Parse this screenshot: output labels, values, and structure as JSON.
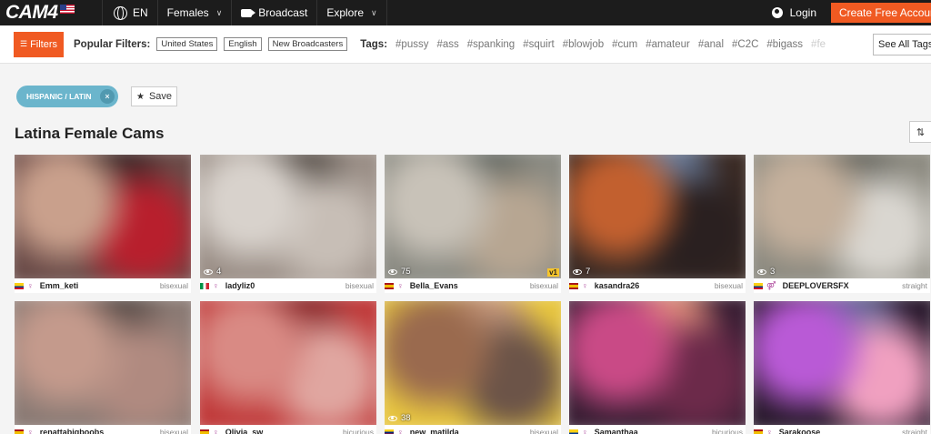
{
  "topbar": {
    "logo": "CAM4",
    "language": "EN",
    "menu": [
      {
        "label": "Females",
        "dropdown": true
      },
      {
        "label": "Broadcast",
        "dropdown": false
      },
      {
        "label": "Explore",
        "dropdown": true
      }
    ],
    "login_label": "Login",
    "create_label": "Create Free Account"
  },
  "filterbar": {
    "filters_label": "Filters",
    "popular_label": "Popular Filters:",
    "popular": [
      "United States",
      "English",
      "New Broadcasters"
    ],
    "tags_label": "Tags:",
    "tags": [
      "#pussy",
      "#ass",
      "#spanking",
      "#squirt",
      "#blowjob",
      "#cum",
      "#amateur",
      "#anal",
      "#C2C",
      "#bigass",
      "#fe"
    ],
    "see_all_label": "See All Tags"
  },
  "active_filter": {
    "label": "HISPANIC / LATIN",
    "remove_icon": "×"
  },
  "save_label": "Save",
  "page_title": "Latina Female Cams",
  "colors": {
    "accent": "#f05a22",
    "pill": "#6bb5cc",
    "topbar": "#1c1c1c"
  },
  "cams": [
    {
      "name": "Emm_keti",
      "orientation": "bisexual",
      "viewers": "",
      "flag": "CO",
      "gender": "♀",
      "badge": "",
      "palette": [
        "#6a4b48",
        "#c9a08c",
        "#3d2a2a",
        "#b81f2d"
      ]
    },
    {
      "name": "ladyliz0",
      "orientation": "bisexual",
      "viewers": "4",
      "flag": "IT",
      "gender": "♀",
      "badge": "",
      "palette": [
        "#9a8e86",
        "#d8d2cc",
        "#5e5650",
        "#c7beb6"
      ]
    },
    {
      "name": "Bella_Evans",
      "orientation": "bisexual",
      "viewers": "75",
      "flag": "ES",
      "gender": "♀",
      "badge": "v1",
      "palette": [
        "#8a8a82",
        "#c8c2b8",
        "#6a6e68",
        "#b7a692"
      ]
    },
    {
      "name": "kasandra26",
      "orientation": "bisexual",
      "viewers": "7",
      "flag": "ES",
      "gender": "♀",
      "badge": "",
      "palette": [
        "#3a2a24",
        "#c2602f",
        "#6a7d9c",
        "#2a2020"
      ]
    },
    {
      "name": "DEEPLOVERSFX",
      "orientation": "straight",
      "viewers": "3",
      "flag": "CO",
      "gender": "⚤",
      "badge": "",
      "palette": [
        "#8c8a80",
        "#c4b09c",
        "#6b6a62",
        "#d9d6d0"
      ]
    },
    {
      "name": "renattabigboobs",
      "orientation": "bisexual",
      "viewers": "",
      "flag": "ES",
      "gender": "♀",
      "badge": "",
      "palette": [
        "#8a7a74",
        "#c49a8c",
        "#5a4e4a",
        "#b08a80"
      ]
    },
    {
      "name": "Olivia_sw",
      "orientation": "bicurious",
      "viewers": "",
      "flag": "ES",
      "gender": "♀",
      "badge": "",
      "palette": [
        "#c03a3a",
        "#d98a84",
        "#8a2a2c",
        "#e0a6a0"
      ]
    },
    {
      "name": "new_matilda",
      "orientation": "bisexual",
      "viewers": "38",
      "flag": "VE",
      "gender": "♀",
      "badge": "",
      "palette": [
        "#e8c640",
        "#9a6a4e",
        "#c79a7e",
        "#6c5448"
      ]
    },
    {
      "name": "Samanthaa",
      "orientation": "bicurious",
      "viewers": "",
      "flag": "CO",
      "gender": "♀",
      "badge": "",
      "palette": [
        "#3a1e34",
        "#c94a86",
        "#e0907c",
        "#6c2a4a"
      ]
    },
    {
      "name": "Sarakoose",
      "orientation": "straight",
      "viewers": "",
      "flag": "ES",
      "gender": "♀",
      "badge": "",
      "palette": [
        "#2a1a2e",
        "#b95ad6",
        "#6a6a9a",
        "#f0a0c0"
      ]
    }
  ]
}
